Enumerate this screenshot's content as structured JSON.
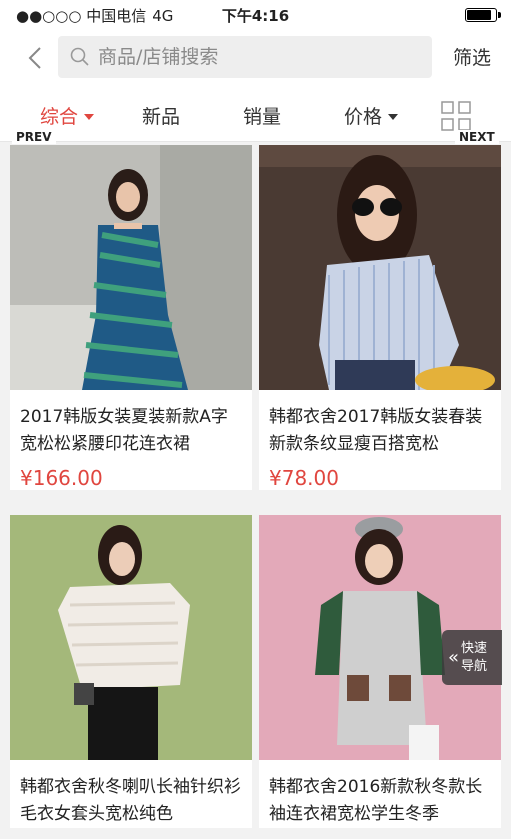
{
  "status_bar": {
    "carrier": "●●○○○ 中国电信",
    "network": "4G",
    "time": "下午4:16",
    "battery_level": 0.85
  },
  "search": {
    "placeholder": "商品/店铺搜索",
    "filter_label": "筛选"
  },
  "tabs": [
    {
      "label": "综合",
      "active": true,
      "has_caret": true
    },
    {
      "label": "新品",
      "active": false,
      "has_caret": false
    },
    {
      "label": "销量",
      "active": false,
      "has_caret": false
    },
    {
      "label": "价格",
      "active": false,
      "has_caret": true
    }
  ],
  "carousel": {
    "prev_label": "PREV",
    "next_label": "NEXT"
  },
  "products": [
    {
      "title": "2017韩版女装夏装新款A字宽松松紧腰印花连衣裙",
      "price": "¥166.00"
    },
    {
      "title": "韩都衣舍2017韩版女装春装新款条纹显瘦百搭宽松",
      "price": "¥78.00"
    },
    {
      "title": "韩都衣舍秋冬喇叭长袖针织衫毛衣女套头宽松纯色",
      "price": ""
    },
    {
      "title": "韩都衣舍2016新款秋冬款长袖连衣裙宽松学生冬季",
      "price": ""
    }
  ],
  "quick_nav": {
    "line1": "快速",
    "line2": "导航"
  },
  "colors": {
    "accent": "#e0463f",
    "background": "#f2f2f2"
  }
}
